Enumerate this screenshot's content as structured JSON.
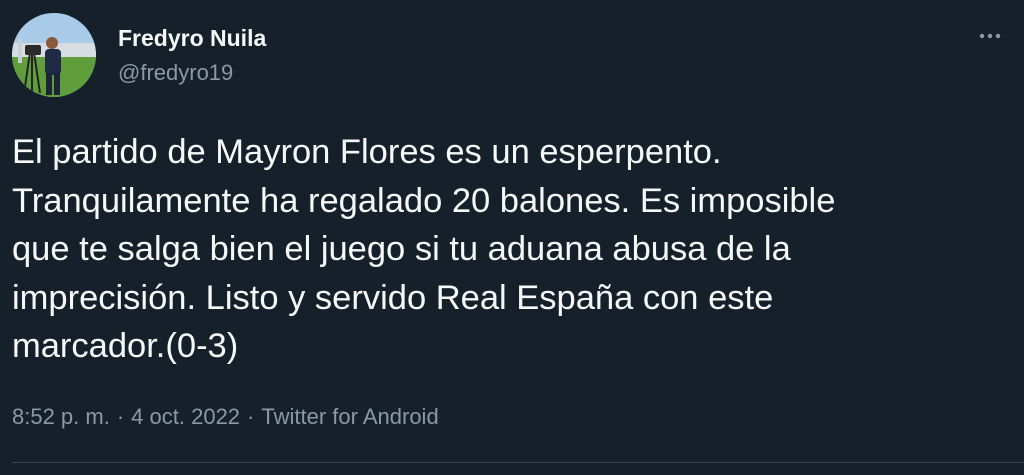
{
  "author": {
    "name": "Fredyro Nuila",
    "handle": "@fredyro19",
    "avatar_icon": "profile-photo"
  },
  "tweet": {
    "text": "El partido de Mayron Flores es un esperpento.\nTranquilamente ha regalado 20 balones. Es imposible\nque te salga bien el juego si tu aduana abusa de la\nimprecisión. Listo y servido Real España con este\nmarcador.(0-3)"
  },
  "meta": {
    "time": "8:52 p. m.",
    "separator": "·",
    "date": "4 oct. 2022",
    "source": "Twitter for Android"
  },
  "more_icon": "more-dots-icon",
  "colors": {
    "background": "#15202b",
    "primary_text": "#f7f9f9",
    "secondary_text": "#8b98a5"
  }
}
